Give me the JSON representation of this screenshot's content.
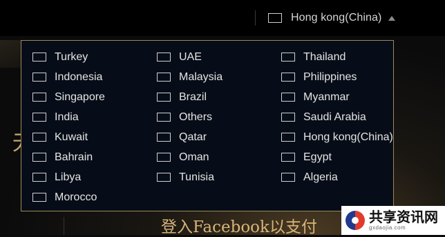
{
  "header": {
    "region_label": "Hong kong(China)",
    "caret_icon": "caret-up-icon"
  },
  "dropdown": {
    "countries": [
      "Turkey",
      "UAE",
      "Thailand",
      "Indonesia",
      "Malaysia",
      "Philippines",
      "Singapore",
      "Brazil",
      "Myanmar",
      "India",
      "Others",
      "Saudi Arabia",
      "Kuwait",
      "Qatar",
      "Hong kong(China)",
      "Bahrain",
      "Oman",
      "Egypt",
      "Libya",
      "Tunisia",
      "Algeria",
      "Morocco"
    ]
  },
  "background": {
    "partial_glyph": "无",
    "bottom_text": "登入Facebook以支付"
  },
  "watermark": {
    "title": "共享资讯网",
    "subtitle": "gxdaojia.com"
  },
  "colors": {
    "panel_bg": "#070d18",
    "panel_border": "#9c8a58",
    "gold_text": "#d8b57a"
  }
}
